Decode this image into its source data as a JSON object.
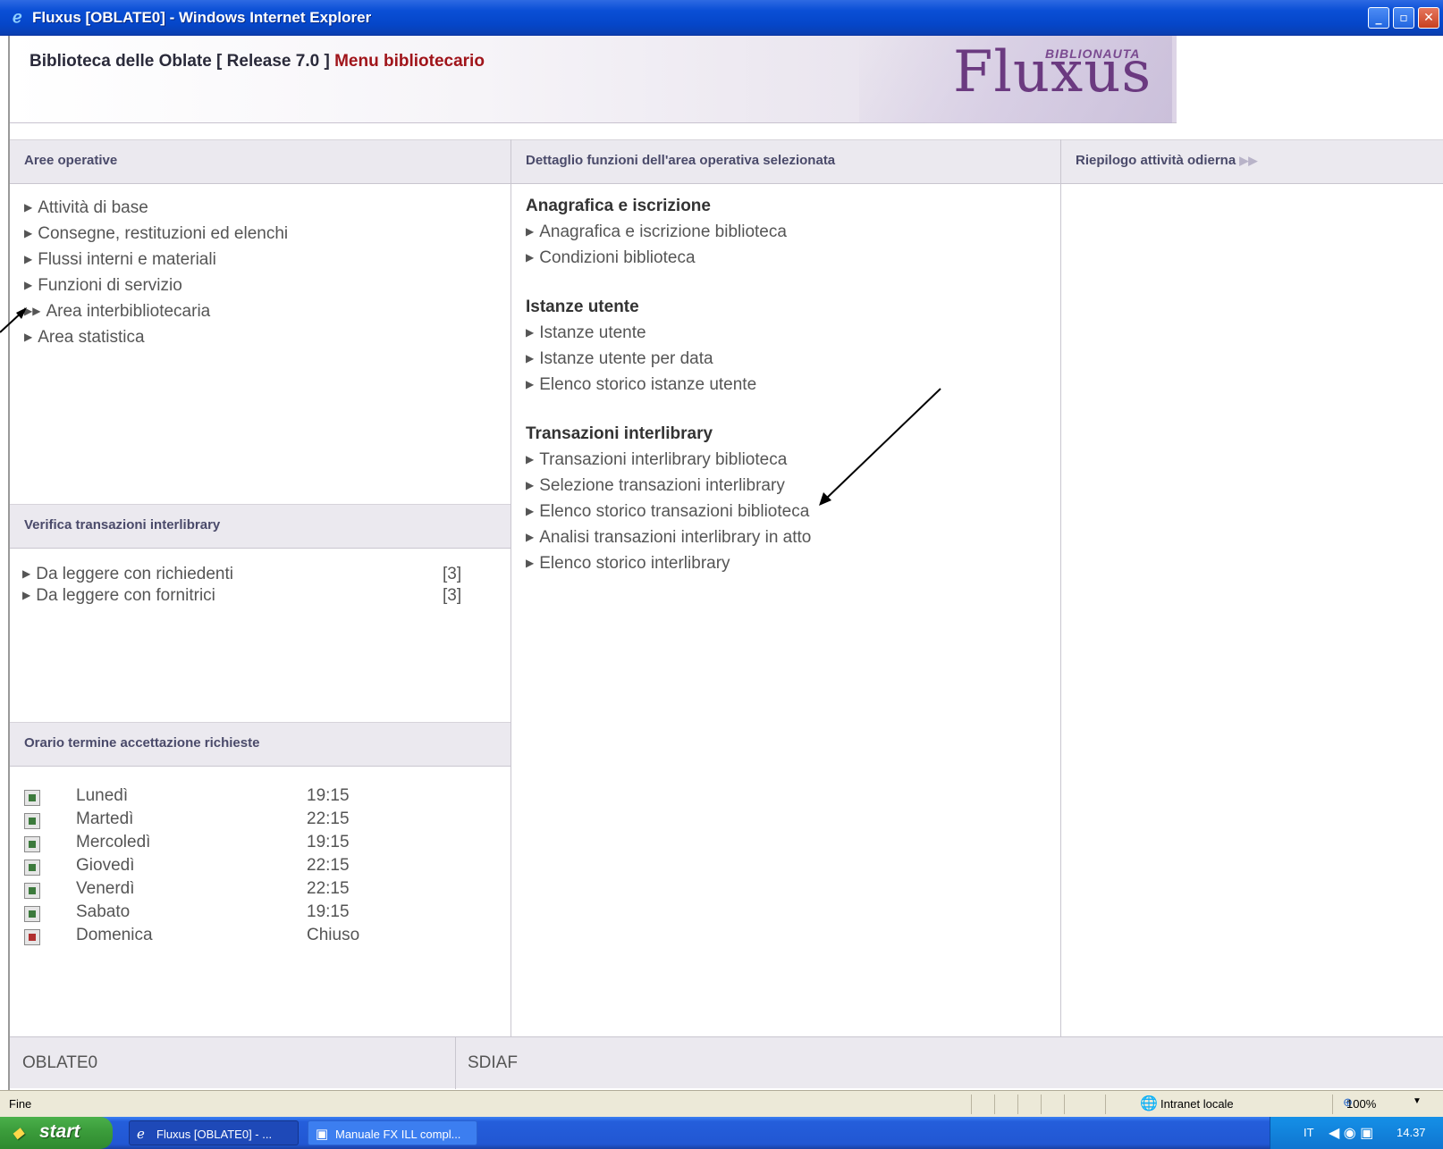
{
  "window": {
    "title": "Fluxus [OBLATE0] - Windows Internet Explorer",
    "icon": "ie-icon",
    "controls": {
      "minimize": "_",
      "maximize": "▫",
      "close": "✕"
    }
  },
  "header": {
    "library": "Biblioteca delle Oblate [ Release 7.0 ]",
    "menu": "Menu bibliotecario",
    "logo": "Fluxus",
    "logo_tag": "BIBLIONAUTA"
  },
  "left": {
    "heading": "Aree operative",
    "items": [
      "Attività di base",
      "Consegne, restituzioni ed elenchi",
      "Flussi interni e materiali",
      "Funzioni di servizio",
      "Area interbibliotecaria",
      "Area statistica"
    ],
    "selected_index": 4
  },
  "verifica": {
    "heading": "Verifica transazioni interlibrary",
    "items": [
      {
        "label": "Da leggere con richiedenti",
        "count": "[3]"
      },
      {
        "label": "Da leggere con fornitrici",
        "count": "[3]"
      }
    ]
  },
  "orario": {
    "heading": "Orario termine accettazione richieste",
    "rows": [
      {
        "day": "Lunedì",
        "time": "19:15",
        "status": "open"
      },
      {
        "day": "Martedì",
        "time": "22:15",
        "status": "open"
      },
      {
        "day": "Mercoledì",
        "time": "19:15",
        "status": "open"
      },
      {
        "day": "Giovedì",
        "time": "22:15",
        "status": "open"
      },
      {
        "day": "Venerdì",
        "time": "22:15",
        "status": "open"
      },
      {
        "day": "Sabato",
        "time": "19:15",
        "status": "open"
      },
      {
        "day": "Domenica",
        "time": "Chiuso",
        "status": "closed"
      }
    ],
    "colors": {
      "open": "#3c7a3c",
      "closed": "#b03030"
    }
  },
  "middle": {
    "heading": "Dettaglio funzioni dell'area operativa selezionata",
    "groups": [
      {
        "title": "Anagrafica e iscrizione",
        "items": [
          "Anagrafica e iscrizione biblioteca",
          "Condizioni biblioteca"
        ]
      },
      {
        "title": "Istanze utente",
        "items": [
          "Istanze utente",
          "Istanze utente per data",
          "Elenco storico istanze utente"
        ]
      },
      {
        "title": "Transazioni interlibrary",
        "items": [
          "Transazioni interlibrary biblioteca",
          "Selezione transazioni interlibrary",
          "Elenco storico transazioni biblioteca",
          "Analisi transazioni interlibrary in atto",
          "Elenco storico interlibrary"
        ]
      }
    ]
  },
  "right": {
    "heading": "Riepilogo attività odierna"
  },
  "footer": {
    "left": "OBLATE0",
    "right": "SDIAF"
  },
  "statusbar": {
    "text": "Fine",
    "zone": "Intranet locale",
    "zoom": "100%"
  },
  "taskbar": {
    "start": "start",
    "tasks": [
      "Fluxus [OBLATE0] - ...",
      "Manuale FX ILL compl..."
    ],
    "lang": "IT",
    "clock": "14.37"
  },
  "colors": {
    "title_bar": "#0a4fd6",
    "menu_red": "#a0141a",
    "logo": "#6b3a80",
    "panel_header": "#ebe9ef"
  }
}
